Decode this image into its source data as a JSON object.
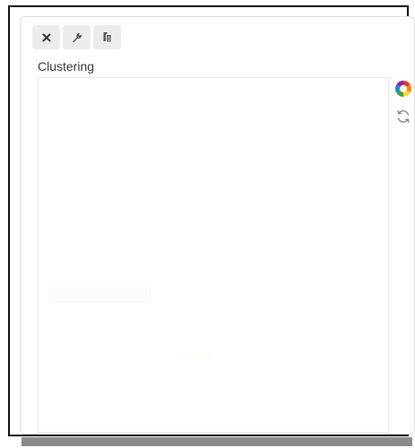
{
  "widget": {
    "title": "Clustering",
    "toolbar": [
      {
        "icon": "close-icon",
        "tooltip": ""
      },
      {
        "icon": "wrench-icon",
        "tooltip": ""
      },
      {
        "icon": "copy-icon",
        "tooltip": ""
      }
    ],
    "side_tools": [
      {
        "icon": "color-wheel-icon"
      },
      {
        "icon": "refresh-icon"
      }
    ]
  },
  "colors": {
    "frame_border": "#111111",
    "panel_border": "#dedede",
    "button_bg": "#ececec",
    "title_text": "#333333",
    "shadow": "#8b8b8b"
  }
}
